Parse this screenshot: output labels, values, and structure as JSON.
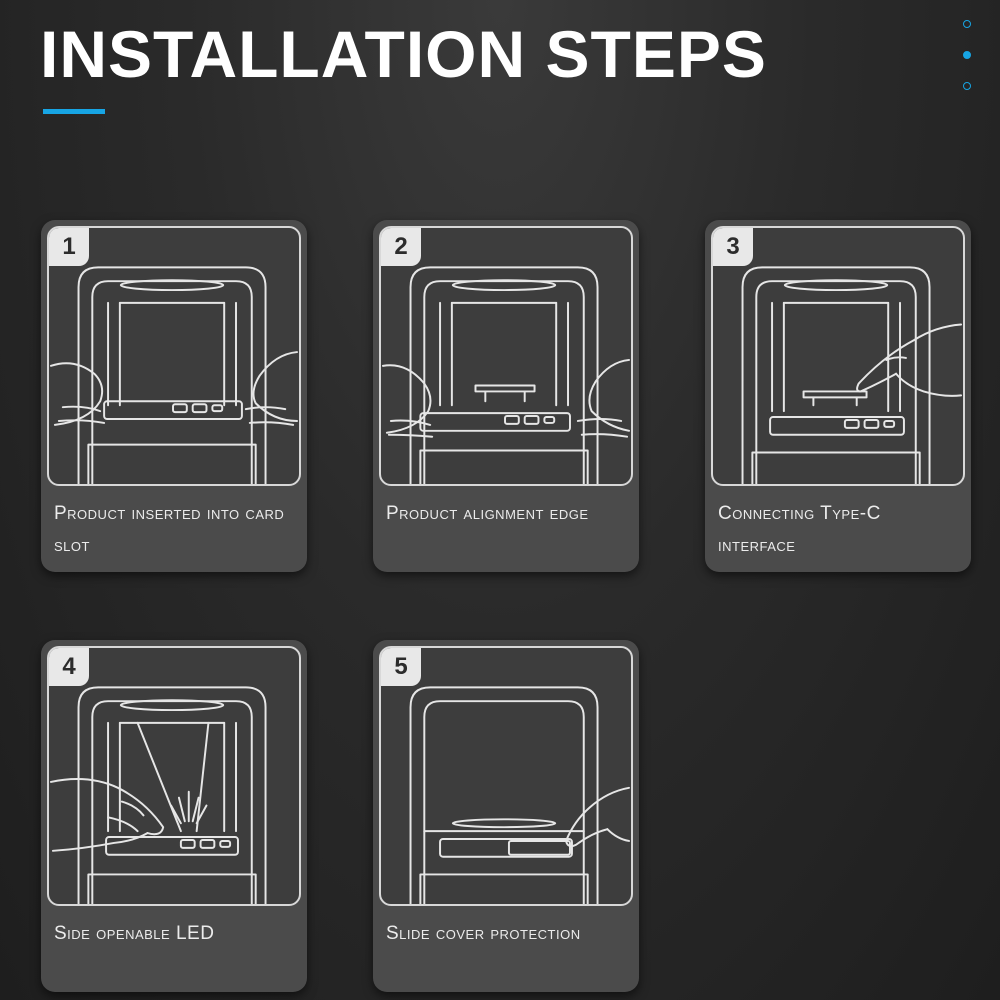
{
  "header": {
    "title": "INSTALLATION STEPS",
    "accent_color": "#17a5e4",
    "pager": {
      "count": 3,
      "active_index": 1
    }
  },
  "steps": [
    {
      "number": "1",
      "caption": "Product inserted into card slot",
      "illustration": "hands-insert-product-icon"
    },
    {
      "number": "2",
      "caption": "Product alignment edge",
      "illustration": "hands-align-edge-icon"
    },
    {
      "number": "3",
      "caption": "Connecting Type-C interface",
      "illustration": "finger-connect-typec-icon"
    },
    {
      "number": "4",
      "caption": "Side openable LED",
      "illustration": "hand-open-led-icon"
    },
    {
      "number": "5",
      "caption": "Slide cover protection",
      "illustration": "finger-slide-cover-icon"
    }
  ]
}
